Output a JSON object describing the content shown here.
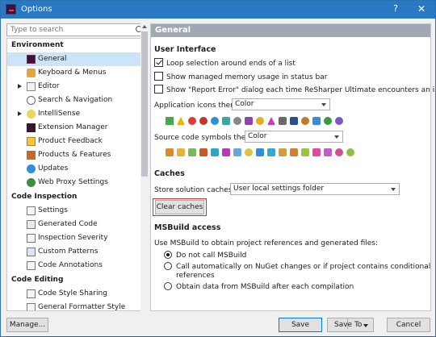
{
  "window": {
    "title": "Options",
    "help": "?",
    "close": "✕"
  },
  "search": {
    "placeholder": "Type to search"
  },
  "tree": {
    "groups": [
      {
        "label": "Environment"
      },
      {
        "label": "Code Inspection"
      },
      {
        "label": "Code Editing"
      }
    ],
    "items": [
      "General",
      "Keyboard & Menus",
      "Editor",
      "Search & Navigation",
      "IntelliSense",
      "Extension Manager",
      "Product Feedback",
      "Products & Features",
      "Updates",
      "Web Proxy Settings",
      "Settings",
      "Generated Code",
      "Inspection Severity",
      "Custom Patterns",
      "Code Annotations",
      "Code Style Sharing",
      "General Formatter Style"
    ]
  },
  "panel": {
    "header": "General",
    "ui_section": "User Interface",
    "loop_selection": "Loop selection around ends of a list",
    "show_memory": "Show managed memory usage in status bar",
    "report_error": "Show \"Report Error\" dialog each time ReSharper Ultimate encounters an internal error",
    "app_icons_label": "Application icons theme:",
    "app_icons_value": "Color",
    "source_symbols_label": "Source code symbols theme:",
    "source_symbols_value": "Color",
    "caches_section": "Caches",
    "store_caches_label": "Store solution caches in:",
    "store_caches_value": "User local settings folder",
    "clear_caches": "Clear caches",
    "msbuild_section": "MSBuild access",
    "msbuild_desc": "Use MSBuild to obtain project references and generated files:",
    "radio_1": "Do not call MSBuild",
    "radio_2_line1": "Call automatically on NuGet changes or if project contains conditional",
    "radio_2_line2": "references",
    "radio_3": "Obtain data from MSBuild after each compilation"
  },
  "footer": {
    "manage": "Manage...",
    "save": "Save",
    "save_to": "Save To",
    "cancel": "Cancel"
  },
  "colors": {
    "titlebar": "#2b78c2",
    "selection": "#cce4f7",
    "panel_header": "#9fa8b3",
    "highlight": "#d9272e"
  }
}
